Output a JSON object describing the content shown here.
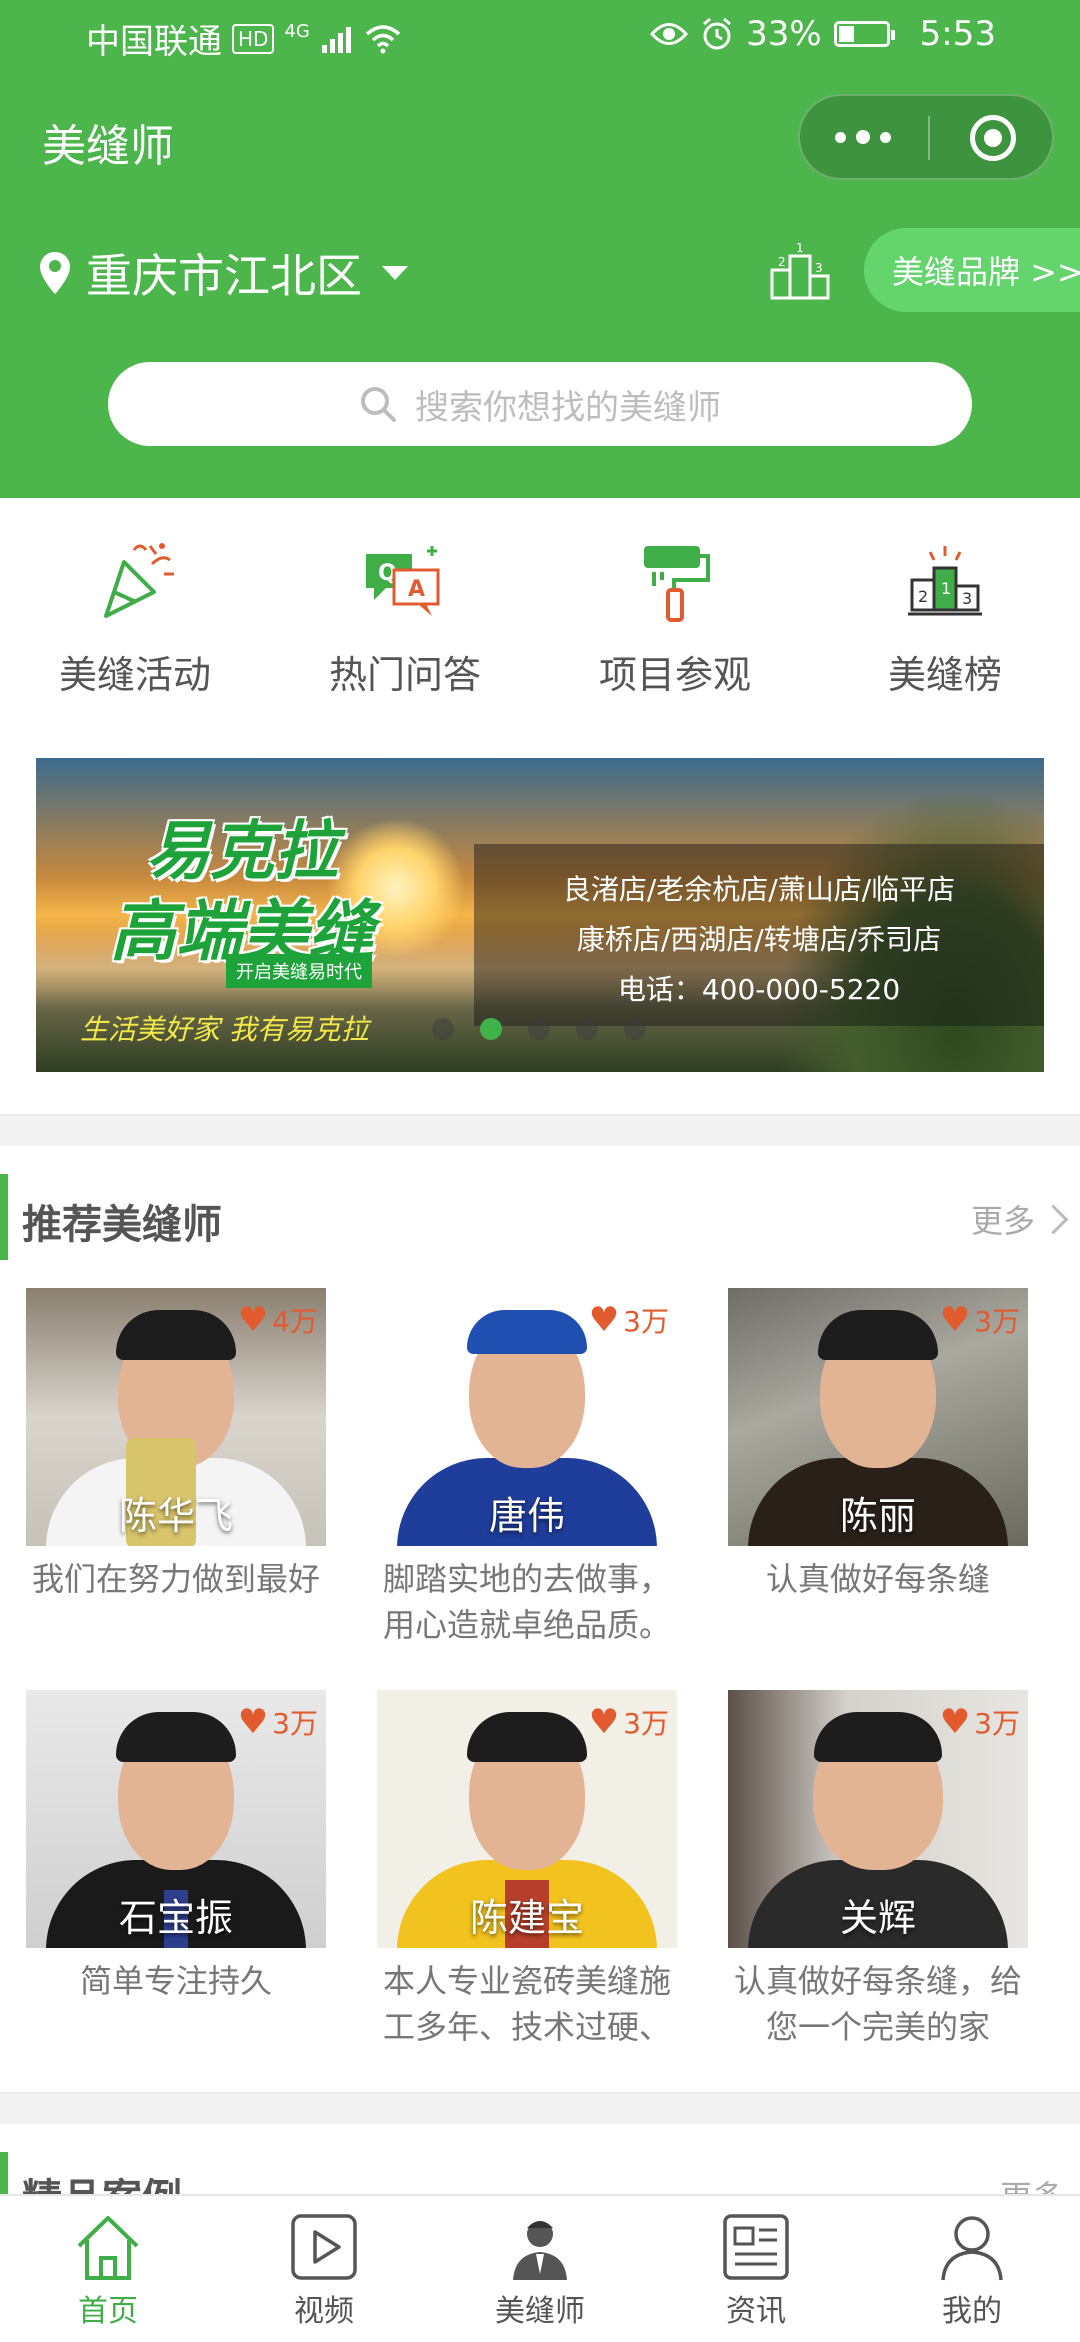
{
  "status_bar": {
    "carrier": "中国联通",
    "hd": "HD",
    "network": "4G",
    "battery_text": "33%",
    "battery_level": 0.33,
    "time": "5:53"
  },
  "nav": {
    "title": "美缝师"
  },
  "location": {
    "city": "重庆市江北区",
    "brand_button": "美缝品牌 >>"
  },
  "search": {
    "placeholder": "搜索你想找的美缝师"
  },
  "quick_menu": [
    {
      "label": "美缝活动",
      "icon": "party-popper-icon"
    },
    {
      "label": "热门问答",
      "icon": "qa-chat-icon"
    },
    {
      "label": "项目参观",
      "icon": "paint-roller-icon"
    },
    {
      "label": "美缝榜",
      "icon": "podium-ranking-icon"
    }
  ],
  "banner": {
    "title_line1": "易克拉",
    "title_line2": "高端美缝",
    "tag": "开启美缝易时代",
    "slogan": "生活美好家  我有易克拉",
    "stores_line1": "良渚店/老余杭店/萧山店/临平店",
    "stores_line2": "康桥店/西湖店/转塘店/乔司店",
    "phone": "电话：400-000-5220",
    "slide_count": 5,
    "active_slide": 2
  },
  "recommended": {
    "title": "推荐美缝师",
    "more": "更多",
    "artisans": [
      {
        "name": "陈华飞",
        "likes": "4万",
        "desc": "我们在努力做到最好"
      },
      {
        "name": "唐伟",
        "likes": "3万",
        "desc": "脚踏实地的去做事，用心造就卓绝品质。"
      },
      {
        "name": "陈丽",
        "likes": "3万",
        "desc": "认真做好每条缝"
      },
      {
        "name": "石宝振",
        "likes": "3万",
        "desc": "简单专注持久"
      },
      {
        "name": "陈建宝",
        "likes": "3万",
        "desc": "本人专业瓷砖美缝施工多年、技术过硬、"
      },
      {
        "name": "关辉",
        "likes": "3万",
        "desc": "认真做好每条缝，给您一个完美的家"
      }
    ]
  },
  "featured": {
    "title": "精品案例",
    "more": "更多"
  },
  "tab_bar": [
    {
      "label": "首页",
      "icon": "home-icon",
      "active": true
    },
    {
      "label": "视频",
      "icon": "video-play-icon",
      "active": false
    },
    {
      "label": "美缝师",
      "icon": "worker-icon",
      "active": false
    },
    {
      "label": "资讯",
      "icon": "news-icon",
      "active": false
    },
    {
      "label": "我的",
      "icon": "user-icon",
      "active": false
    }
  ],
  "colors": {
    "brand_green": "#4cb54c",
    "heart_orange": "#e25b2f"
  }
}
